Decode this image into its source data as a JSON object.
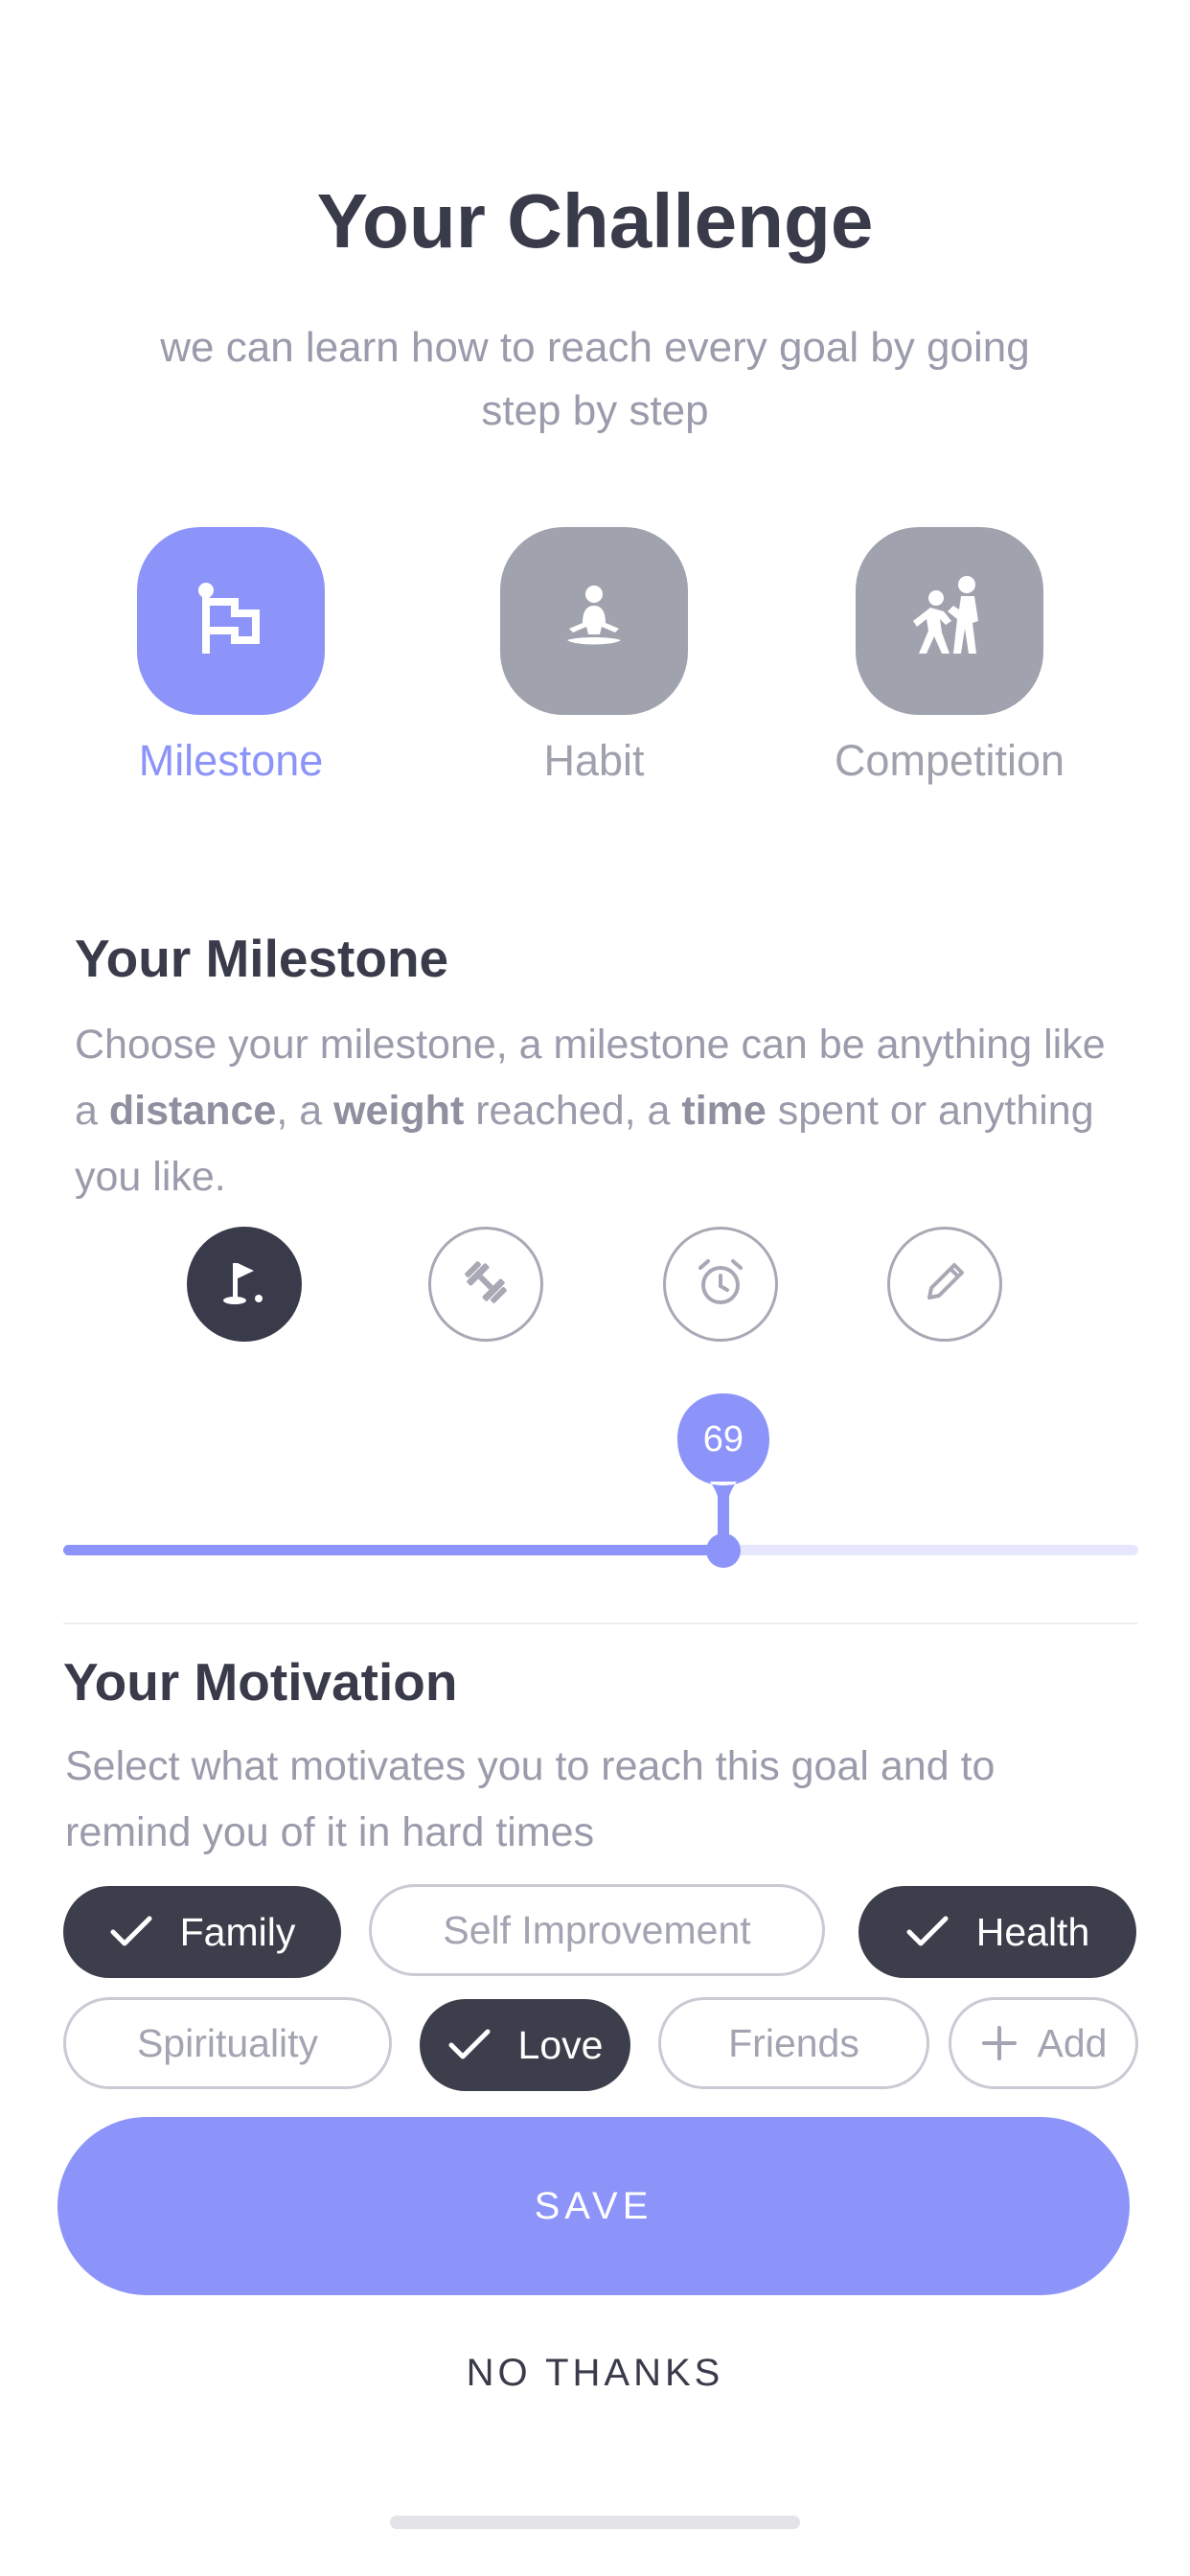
{
  "header": {
    "title": "Your Challenge",
    "subtitle": "we can learn how to reach every goal by going step by step"
  },
  "challenge_types": [
    {
      "label": "Milestone",
      "icon": "flag-icon",
      "selected": true
    },
    {
      "label": "Habit",
      "icon": "meditation-icon",
      "selected": false
    },
    {
      "label": "Competition",
      "icon": "competition-icon",
      "selected": false
    }
  ],
  "milestone": {
    "title": "Your Milestone",
    "desc": {
      "part1": "Choose your milestone, a milestone can be anything like a ",
      "b1": "distance",
      "part2": ", a ",
      "b2": "weight",
      "part3": " reached, a ",
      "b3": "time",
      "part4": " spent or anything you like."
    },
    "kinds": [
      {
        "icon": "golf-flag-icon",
        "selected": true
      },
      {
        "icon": "dumbbell-icon",
        "selected": false
      },
      {
        "icon": "alarm-clock-icon",
        "selected": false
      },
      {
        "icon": "pencil-icon",
        "selected": false
      }
    ],
    "slider": {
      "value": "69",
      "fraction": 0.614
    }
  },
  "motivation": {
    "title": "Your Motivation",
    "desc": "Select what motivates you to reach this goal and to remind you of it in hard times",
    "chips": [
      {
        "label": "Family",
        "selected": true
      },
      {
        "label": "Self Improvement",
        "selected": false
      },
      {
        "label": "Health",
        "selected": true
      },
      {
        "label": "Spirituality",
        "selected": false
      },
      {
        "label": "Love",
        "selected": true
      },
      {
        "label": "Friends",
        "selected": false
      },
      {
        "label": "Add",
        "selected": false
      }
    ]
  },
  "actions": {
    "save_label": "SAVE",
    "no_thanks_label": "NO THANKS"
  },
  "colors": {
    "accent": "#8c94fa",
    "dark": "#3a3b4a",
    "muted": "#9fa1ad",
    "track": "#e6e7fd"
  }
}
